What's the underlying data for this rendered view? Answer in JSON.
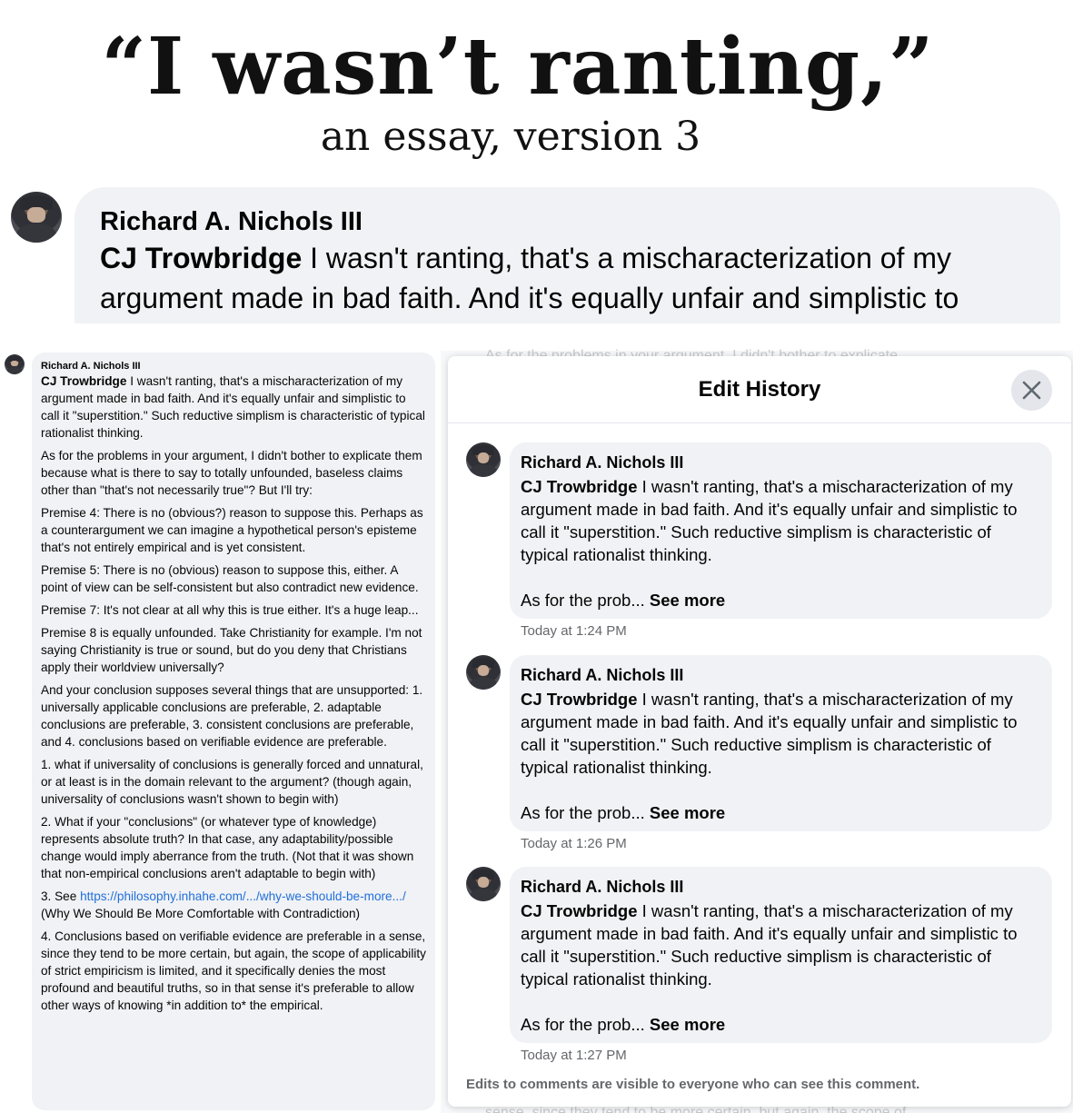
{
  "header": {
    "title": "“I wasn’t ranting,”",
    "subtitle": "an essay, version 3"
  },
  "zoomed_comment": {
    "author": "Richard A. Nichols III",
    "tag": "CJ Trowbridge",
    "text_line1": " I wasn't ranting, that's a mischaracterization of my",
    "text_line2": "argument made in bad faith. And it's equally unfair and simplistic to"
  },
  "full_comment": {
    "author": "Richard A. Nichols III",
    "tag": "CJ Trowbridge",
    "p1": " I wasn't ranting, that's a mischaracterization of my argument made in bad faith. And it's equally unfair and simplistic to call it \"superstition.\" Such reductive simplism is characteristic of typical rationalist thinking.",
    "p2": "As for the problems in your argument, I didn't bother to explicate them because what is there to say to totally unfounded, baseless claims other than \"that's not necessarily true\"? But I'll try:",
    "p3": "Premise 4: There is no (obvious?) reason to suppose this. Perhaps as a counterargument we can imagine a hypothetical person's episteme that's not entirely empirical and is yet consistent.",
    "p4": "Premise 5: There is no (obvious) reason to suppose this, either. A point of view can be self-consistent but also contradict new evidence.",
    "p5": "Premise 7: It's not clear at all why this is true either. It's a huge leap...",
    "p6": "Premise 8 is equally unfounded. Take Christianity for example. I'm not saying Christianity is true or sound, but do you deny that Christians apply their worldview universally?",
    "p7": "And your conclusion supposes several things that are unsupported: 1. universally applicable conclusions are preferable, 2. adaptable conclusions are preferable, 3. consistent conclusions are preferable, and 4. conclusions based on verifiable evidence are preferable.",
    "p8": "1. what if universality of conclusions is generally forced and unnatural, or at least is in the domain relevant to the argument? (though again, universality of conclusions wasn't shown to begin with)",
    "p9": "2. What if your \"conclusions\" (or whatever type of knowledge) represents absolute truth? In that case, any adaptability/possible change would imply aberrance from the truth. (Not that it was shown that non-empirical conclusions aren't adaptable to begin with)",
    "p10_prefix": "3. See ",
    "p10_link": "https://philosophy.inhahe.com/.../why-we-should-be-more.../",
    "p10_suffix": "(Why We Should Be More Comfortable with Contradiction)",
    "p11": "4. Conclusions based on verifiable evidence are preferable in a sense, since they tend to be more certain, but again, the scope of applicability of strict empiricism is limited, and it specifically denies the most profound and beautiful truths, so in that sense it's preferable to allow other ways of knowing *in addition to* the empirical."
  },
  "background": {
    "faded_top": "As for the problems in your argument, I didn't bother to explicate",
    "faded_bottom": "sense, since they tend to be more certain, but again, the scope of"
  },
  "edit_history": {
    "title": "Edit History",
    "entries": [
      {
        "author": "Richard A. Nichols III",
        "tag": "CJ Trowbridge",
        "text": " I wasn't ranting, that's a mischaracterization of my argument made in bad faith. And it's equally unfair and simplistic to call it \"superstition.\" Such reductive simplism is characteristic of typical rationalist thinking.",
        "preview": "As for the prob...",
        "see_more": "See more",
        "time": "Today at 1:24 PM"
      },
      {
        "author": "Richard A. Nichols III",
        "tag": "CJ Trowbridge",
        "text": " I wasn't ranting, that's a mischaracterization of my argument made in bad faith. And it's equally unfair and simplistic to call it \"superstition.\" Such reductive simplism is characteristic of typical rationalist thinking.",
        "preview": "As for the prob...",
        "see_more": "See more",
        "time": "Today at 1:26 PM"
      },
      {
        "author": "Richard A. Nichols III",
        "tag": "CJ Trowbridge",
        "text": " I wasn't ranting, that's a mischaracterization of my argument made in bad faith. And it's equally unfair and simplistic to call it \"superstition.\" Such reductive simplism is characteristic of typical rationalist thinking.",
        "preview": "As for the prob...",
        "see_more": "See more",
        "time": "Today at 1:27 PM"
      }
    ],
    "footer": "Edits to comments are visible to everyone who can see this comment."
  }
}
